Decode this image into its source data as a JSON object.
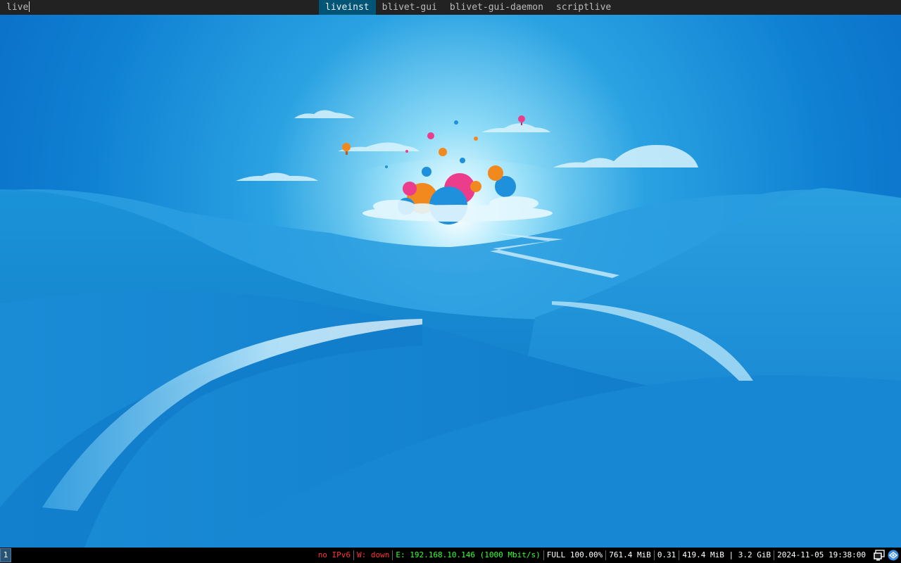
{
  "dmenu": {
    "input": "live",
    "items": [
      {
        "label": "liveinst",
        "selected": true
      },
      {
        "label": "blivet-gui",
        "selected": false
      },
      {
        "label": "blivet-gui-daemon",
        "selected": false
      },
      {
        "label": "scriptlive",
        "selected": false
      }
    ]
  },
  "bar": {
    "workspace": "1",
    "status": {
      "ipv6": "no IPv6",
      "wireless": "W: down",
      "ethernet": "E: 192.168.10.146 (1000 Mbit/s)",
      "battery": "FULL 100.00%",
      "memory": "761.4 MiB",
      "load": "0.31",
      "disk": "419.4 MiB | 3.2 GiB",
      "datetime": "2024-11-05 19:38:00"
    },
    "tray": [
      "monitor-icon",
      "network-manager-icon"
    ]
  },
  "colors": {
    "bar_bg": "#222222",
    "selected_bg": "#005577",
    "status_bad": "#ff3333",
    "status_good": "#33ff33",
    "workspace_bg": "#285577"
  }
}
